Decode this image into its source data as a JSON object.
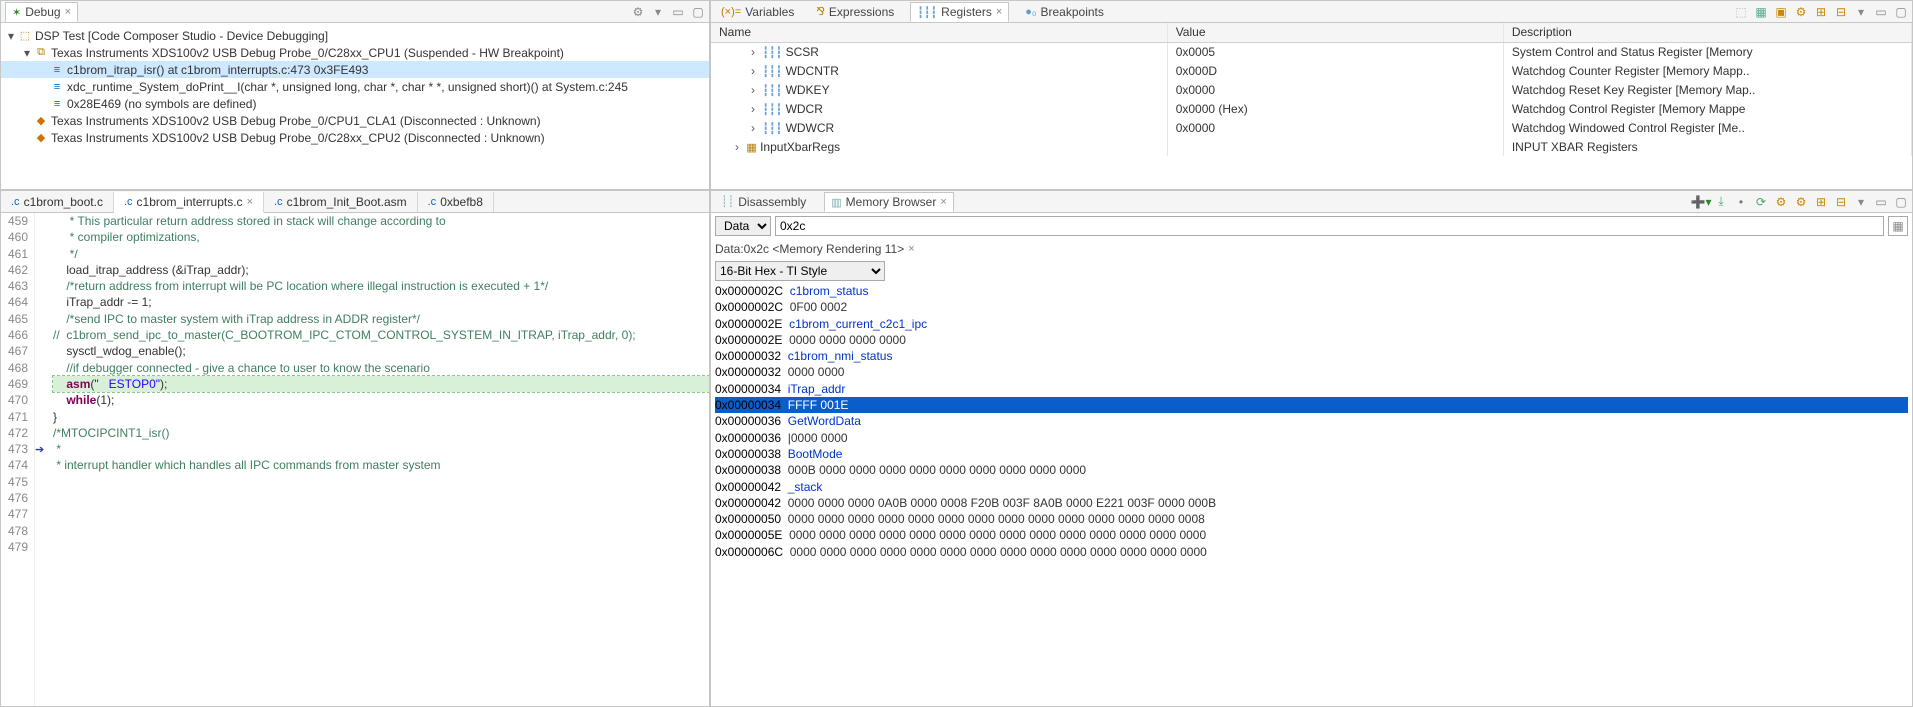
{
  "debug": {
    "tab_label": "Debug",
    "root": {
      "label": "DSP Test [Code Composer Studio - Device Debugging]",
      "children": [
        {
          "label": "Texas Instruments XDS100v2 USB Debug Probe_0/C28xx_CPU1 (Suspended - HW Breakpoint)",
          "icon": "thread-icon",
          "children": [
            {
              "label": "c1brom_itrap_isr() at c1brom_interrupts.c:473 0x3FE493",
              "icon": "stackframe-icon",
              "selected": true
            },
            {
              "label": "xdc_runtime_System_doPrint__I(char *, unsigned long, char *, char * *, unsigned short)() at System.c:245",
              "icon": "stackframe-icon"
            },
            {
              "label": "0x28E469  (no symbols are defined)",
              "icon": "stackframe-icon"
            }
          ]
        },
        {
          "label": "Texas Instruments XDS100v2 USB Debug Probe_0/CPU1_CLA1 (Disconnected : Unknown)",
          "icon": "thread-disc-icon"
        },
        {
          "label": "Texas Instruments XDS100v2 USB Debug Probe_0/C28xx_CPU2 (Disconnected : Unknown)",
          "icon": "thread-disc-icon"
        }
      ]
    }
  },
  "registers": {
    "tabs": [
      "Variables",
      "Expressions",
      "Registers",
      "Breakpoints"
    ],
    "active_tab": "Registers",
    "columns": {
      "name": "Name",
      "value": "Value",
      "desc": "Description"
    },
    "rows": [
      {
        "name": "SCSR",
        "value": "0x0005",
        "desc": "System Control and Status Register [Memory"
      },
      {
        "name": "WDCNTR",
        "value": "0x000D",
        "desc": "Watchdog Counter Register [Memory Mapp.."
      },
      {
        "name": "WDKEY",
        "value": "0x0000",
        "desc": "Watchdog Reset Key Register [Memory Map.."
      },
      {
        "name": "WDCR",
        "value": "0x0000 (Hex)",
        "desc": "Watchdog Control Register [Memory Mappe"
      },
      {
        "name": "WDWCR",
        "value": "0x0000",
        "desc": "Watchdog Windowed Control Register [Me.."
      }
    ],
    "group_row": {
      "name": "InputXbarRegs",
      "desc": "INPUT XBAR Registers"
    }
  },
  "editor": {
    "tabs": [
      {
        "label": "c1brom_boot.c"
      },
      {
        "label": "c1brom_interrupts.c",
        "active": true,
        "closable": true
      },
      {
        "label": "c1brom_Init_Boot.asm"
      },
      {
        "label": "0xbefb8"
      }
    ],
    "first_line": 459,
    "current_line": 473,
    "lines": [
      {
        "n": 459,
        "cls": "com",
        "text": "     * This particular return address stored in stack will change according to"
      },
      {
        "n": 460,
        "cls": "com",
        "text": "     * compiler optimizations,"
      },
      {
        "n": 461,
        "cls": "com",
        "text": "     */"
      },
      {
        "n": 462,
        "text": "    load_itrap_address (&iTrap_addr);"
      },
      {
        "n": 463,
        "text": ""
      },
      {
        "n": 464,
        "cls": "com",
        "text": "    /*return address from interrupt will be PC location where illegal instruction is executed + 1*/"
      },
      {
        "n": 465,
        "text": "    iTrap_addr -= 1;"
      },
      {
        "n": 466,
        "text": ""
      },
      {
        "n": 467,
        "text": ""
      },
      {
        "n": 468,
        "cls": "com",
        "text": "    /*send IPC to master system with iTrap address in ADDR register*/"
      },
      {
        "n": 469,
        "cls": "com",
        "text": "//  c1brom_send_ipc_to_master(C_BOOTROM_IPC_CTOM_CONTROL_SYSTEM_IN_ITRAP, iTrap_addr, 0);"
      },
      {
        "n": 470,
        "text": "    sysctl_wdog_enable();"
      },
      {
        "n": 471,
        "text": ""
      },
      {
        "n": 472,
        "cls": "com",
        "text": "    //if debugger connected - give a chance to user to know the scenario"
      },
      {
        "n": 473,
        "text": "    asm(\"   ESTOP0\");",
        "asm_kw": true,
        "current": true
      },
      {
        "n": 474,
        "text": "    while(1);",
        "while_kw": true
      },
      {
        "n": 475,
        "text": "}"
      },
      {
        "n": 476,
        "text": ""
      },
      {
        "n": 477,
        "cls": "com",
        "text": "/*MTOCIPCINT1_isr()"
      },
      {
        "n": 478,
        "cls": "com",
        "text": " *"
      },
      {
        "n": 479,
        "cls": "com",
        "text": " * interrupt handler which handles all IPC commands from master system"
      }
    ]
  },
  "memory": {
    "tabs": {
      "disassembly": "Disassembly",
      "browser": "Memory Browser"
    },
    "space_select": "Data",
    "address_input": "0x2c",
    "rendering_tab": "Data:0x2c <Memory Rendering 11>",
    "format_select": "16-Bit Hex - TI Style",
    "lines": [
      {
        "addr": "0x0000002C",
        "sym": "c1brom_status"
      },
      {
        "addr": "0x0000002C",
        "data": "0F00 0002"
      },
      {
        "addr": "0x0000002E",
        "sym": "c1brom_current_c2c1_ipc"
      },
      {
        "addr": "0x0000002E",
        "data": "0000 0000 0000 0000"
      },
      {
        "addr": "0x00000032",
        "sym": "c1brom_nmi_status"
      },
      {
        "addr": "0x00000032",
        "data": "0000 0000"
      },
      {
        "addr": "0x00000034",
        "sym": "iTrap_addr"
      },
      {
        "addr": "0x00000034",
        "data": "FFFF 001E",
        "selected": true
      },
      {
        "addr": "0x00000036",
        "sym": "GetWordData"
      },
      {
        "addr": "0x00000036",
        "data": "0000 0000",
        "cursor": true
      },
      {
        "addr": "0x00000038",
        "sym": "BootMode"
      },
      {
        "addr": "0x00000038",
        "data": "000B 0000 0000 0000 0000 0000 0000 0000 0000 0000"
      },
      {
        "addr": "0x00000042",
        "sym": "_stack"
      },
      {
        "addr": "0x00000042",
        "data": "0000 0000 0000 0A0B 0000 0008 F20B 003F 8A0B 0000 E221 003F 0000 000B"
      },
      {
        "addr": "0x00000050",
        "data": "0000 0000 0000 0000 0000 0000 0000 0000 0000 0000 0000 0000 0000 0008"
      },
      {
        "addr": "0x0000005E",
        "data": "0000 0000 0000 0000 0000 0000 0000 0000 0000 0000 0000 0000 0000 0000"
      },
      {
        "addr": "0x0000006C",
        "data": "0000 0000 0000 0000 0000 0000 0000 0000 0000 0000 0000 0000 0000 0000"
      }
    ]
  }
}
